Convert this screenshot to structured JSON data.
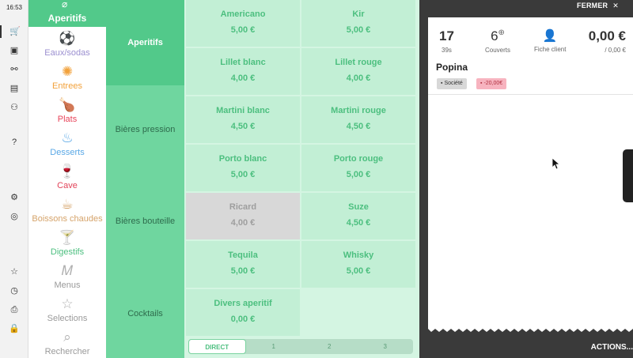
{
  "status": {
    "time": "16:53"
  },
  "rail": {
    "icons": [
      "cart-icon",
      "cash-register-icon",
      "settings-icon",
      "calendar-icon",
      "users-icon",
      "help-icon",
      "gear-icon",
      "dashboard-icon",
      "star-icon",
      "clock-icon",
      "printer-icon",
      "lock-icon"
    ]
  },
  "categories": {
    "active": "Aperitifs",
    "items": [
      {
        "label": "Eaux/sodas",
        "color": "#9b8fd0",
        "icon": "ball-icon"
      },
      {
        "label": "Entrees",
        "color": "#f2a13a",
        "icon": "candy-icon"
      },
      {
        "label": "Plats",
        "color": "#e8445a",
        "icon": "chicken-icon"
      },
      {
        "label": "Desserts",
        "color": "#5aa8e6",
        "icon": "cupcake-icon"
      },
      {
        "label": "Cave",
        "color": "#e2445a",
        "icon": "wine-glass-icon"
      },
      {
        "label": "Boissons chaudes",
        "color": "#d5a36a",
        "icon": "coffee-cup-icon"
      },
      {
        "label": "Digestifs",
        "color": "#4cbf7f",
        "icon": "digestif-glass-icon"
      },
      {
        "label": "Menus",
        "color": "#9a9a9a",
        "icon": "menu-icon"
      },
      {
        "label": "Selections",
        "color": "#9a9a9a",
        "icon": "star-icon"
      },
      {
        "label": "Rechercher",
        "color": "#9a9a9a",
        "icon": "search-icon"
      }
    ]
  },
  "subcategories": [
    "Aperitifs",
    "Bières pression",
    "Bières bouteille",
    "Cocktails"
  ],
  "products": [
    {
      "name": "Americano",
      "price": "5,00 €",
      "disabled": false
    },
    {
      "name": "Kir",
      "price": "5,00 €",
      "disabled": false
    },
    {
      "name": "Lillet blanc",
      "price": "4,00 €",
      "disabled": false
    },
    {
      "name": "Lillet rouge",
      "price": "4,00 €",
      "disabled": false
    },
    {
      "name": "Martini blanc",
      "price": "4,50 €",
      "disabled": false
    },
    {
      "name": "Martini rouge",
      "price": "4,50 €",
      "disabled": false
    },
    {
      "name": "Porto blanc",
      "price": "5,00 €",
      "disabled": false
    },
    {
      "name": "Porto rouge",
      "price": "5,00 €",
      "disabled": false
    },
    {
      "name": "Ricard",
      "price": "4,00 €",
      "disabled": true
    },
    {
      "name": "Suze",
      "price": "4,50 €",
      "disabled": false
    },
    {
      "name": "Tequila",
      "price": "5,00 €",
      "disabled": false
    },
    {
      "name": "Whisky",
      "price": "5,00 €",
      "disabled": false
    },
    {
      "name": "Divers aperitif",
      "price": "0,00 €",
      "disabled": false
    }
  ],
  "pager": {
    "items": [
      "DIRECT",
      "1",
      "2",
      "3"
    ],
    "active": "DIRECT"
  },
  "ticket": {
    "close_label": "FERMER",
    "table_number": "17",
    "elapsed": "39s",
    "covers": "6",
    "covers_label": "Couverts",
    "customer_label": "Fiche client",
    "total_big": "0,00 €",
    "total_sub": "/ 0,00 €",
    "name": "Popina",
    "badge_company": "Société",
    "badge_discount": "-20,00€",
    "actions_label": "ACTIONS..."
  },
  "colors": {
    "accent": "#52c98a",
    "product_text": "#4cbf7f",
    "discount": "#f7b3bf"
  }
}
